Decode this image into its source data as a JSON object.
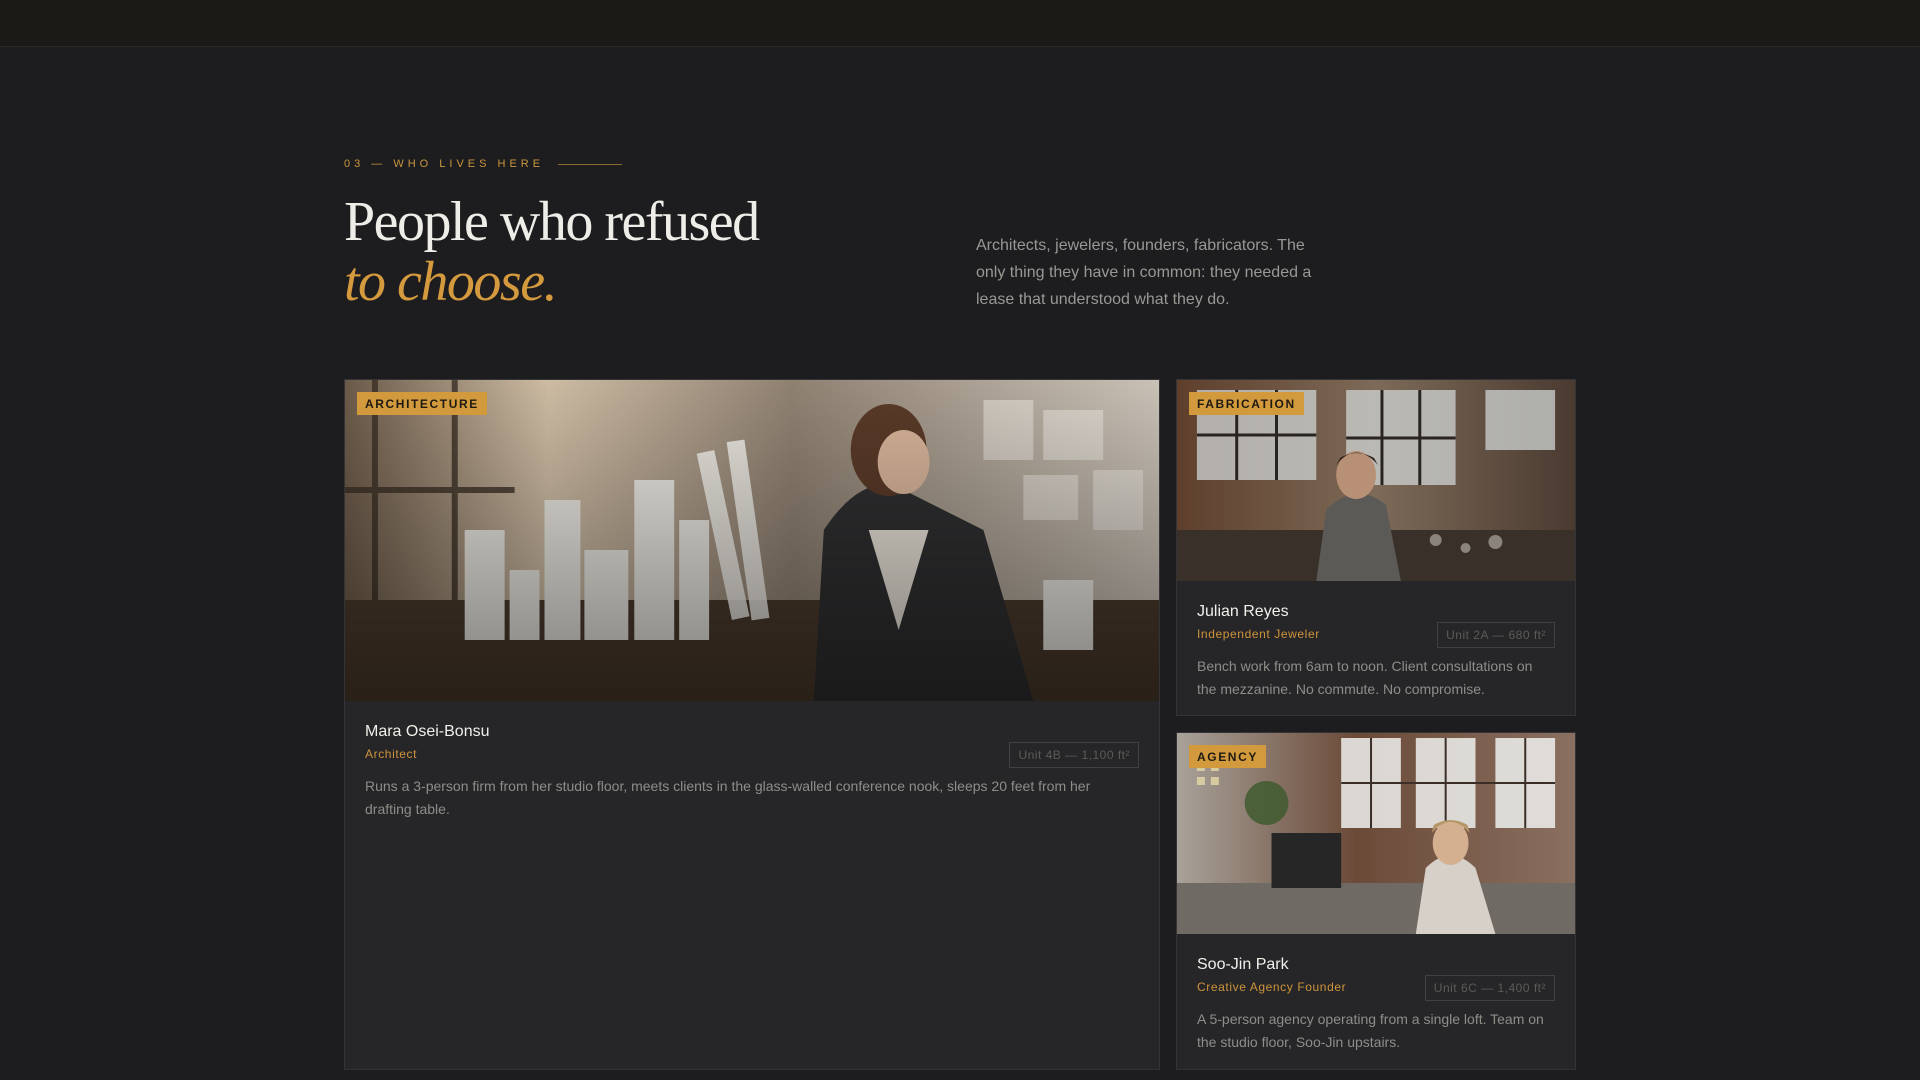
{
  "section": {
    "eyebrow": "03 — WHO LIVES HERE",
    "heading_line1": "People who refused",
    "heading_line2": "to choose.",
    "intro": "Architects, jewelers, founders, fabricators. The only thing they have in common: they needed a lease that understood what they do."
  },
  "residents": [
    {
      "tag": "ARCHITECTURE",
      "name": "Mara Osei-Bonsu",
      "role": "Architect",
      "unit": "Unit 4B — 1,100 ft²",
      "description": "Runs a 3-person firm from her studio floor, meets clients in the glass-walled conference nook, sleeps 20 feet from her drafting table."
    },
    {
      "tag": "FABRICATION",
      "name": "Julian Reyes",
      "role": "Independent Jeweler",
      "unit": "Unit 2A — 680 ft²",
      "description": "Bench work from 6am to noon. Client consultations on the mezzanine. No commute. No compromise."
    },
    {
      "tag": "AGENCY",
      "name": "Soo-Jin Park",
      "role": "Creative Agency Founder",
      "unit": "Unit 6C — 1,400 ft²",
      "description": "A 5-person agency operating from a single loft. Team on the studio floor, Soo-Jin upstairs."
    }
  ],
  "colors": {
    "accent": "#d29a3c",
    "background": "#1d1d1f",
    "card": "#262628"
  }
}
